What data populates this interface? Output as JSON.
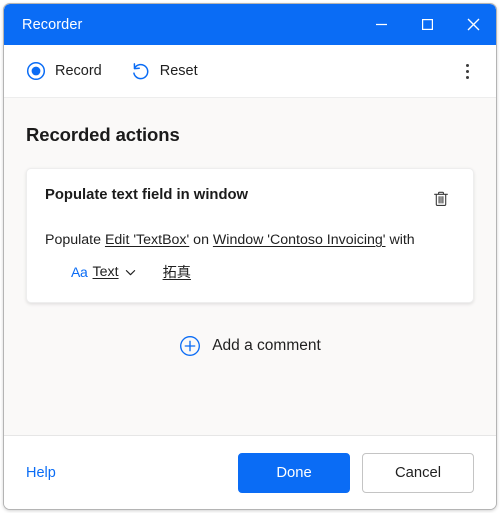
{
  "window": {
    "title": "Recorder",
    "controls": {
      "minimize": "minimize",
      "maximize": "maximize",
      "close": "close"
    }
  },
  "toolbar": {
    "record_label": "Record",
    "reset_label": "Reset",
    "more_label": "More options"
  },
  "main": {
    "section_title": "Recorded actions",
    "action": {
      "title": "Populate text field in window",
      "desc_prefix": "Populate ",
      "desc_target": "Edit 'TextBox'",
      "desc_middle": " on ",
      "desc_window": "Window 'Contoso Invoicing'",
      "desc_suffix": " with",
      "param_icon_label": "Aa",
      "param_name": "Text",
      "param_value": "拓真",
      "delete_label": "Delete"
    },
    "add_comment_label": "Add a comment"
  },
  "footer": {
    "help_label": "Help",
    "done_label": "Done",
    "cancel_label": "Cancel"
  },
  "colors": {
    "accent": "#0a6cf5",
    "titlebar": "#0a6cf5",
    "page_background": "#faf9f8",
    "card_background": "#ffffff",
    "text": "#1f1f1f"
  }
}
